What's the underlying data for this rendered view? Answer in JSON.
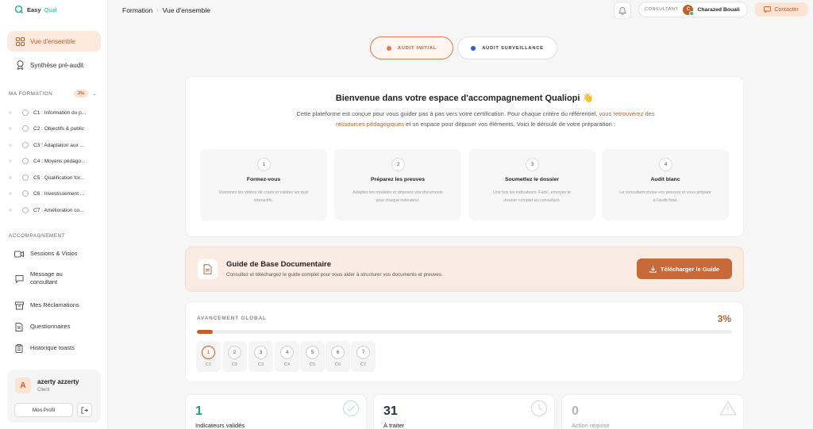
{
  "brand": {
    "name": "Easy",
    "accent": "Qual"
  },
  "sidebar": {
    "nav": [
      {
        "label": "Vue d'ensemble",
        "icon": "grid-icon",
        "active": true
      },
      {
        "label": "Synthèse pré-audit",
        "icon": "award-icon",
        "active": false
      }
    ],
    "formation_title": "MA FORMATION",
    "formation_pct": "3%",
    "criteria": [
      "C1 : Information du p...",
      "C2 : Objectifs & public",
      "C3 : Adaptation aux ...",
      "C4 : Moyens pédago...",
      "C5 : Qualification for...",
      "C6 : Investissement ...",
      "C7 : Amélioration co..."
    ],
    "accompagnement_title": "ACCOMPAGNEMENT",
    "accompagnement": [
      {
        "label": "Sessions & Visios",
        "icon": "video-icon"
      },
      {
        "label": "Message au consultant",
        "icon": "message-icon"
      },
      {
        "label": "Mes Réclamations",
        "icon": "archive-icon"
      },
      {
        "label": "Questionnaires",
        "icon": "document-icon"
      },
      {
        "label": "Historique toasts",
        "icon": "clipboard-icon"
      }
    ],
    "profile": {
      "initial": "A",
      "name": "azerty azzerty",
      "role": "Client",
      "button": "Mon Profil"
    }
  },
  "header": {
    "breadcrumb": [
      "Formation",
      "Vue d'ensemble"
    ],
    "consultant_label": "CONSULTANT",
    "consultant_initial": "C",
    "consultant_name": "Charazed Bouali",
    "contact_label": "Contacter"
  },
  "audit_tabs": [
    {
      "label": "AUDIT INITIAL",
      "active": true,
      "dot_color": "#d77e52"
    },
    {
      "label": "AUDIT SURVEILLANCE",
      "active": false,
      "dot_color": "#2a5fd8"
    }
  ],
  "welcome": {
    "title": "Bienvenue dans votre espace d'accompagnement Qualiopi 👋",
    "text_before": "Cette plateforme est conçue pour vous guider pas à pas vers votre certification. Pour chaque critère du référentiel, ",
    "text_highlight": "vous retrouverez des ressources pédagogiques",
    "text_after": " et un espace pour déposer vos éléments. Voici le déroulé de votre préparation :",
    "steps": [
      {
        "num": "1",
        "title": "Formez-vous",
        "desc": "Visionnez les vidéos de cours et validez les quiz interactifs."
      },
      {
        "num": "2",
        "title": "Préparez les preuves",
        "desc": "Adaptez les modèles et déposez vos documents pour chaque indicateur."
      },
      {
        "num": "3",
        "title": "Soumettez le dossier",
        "desc": "Une fois les indicateurs 'Faits', envoyez le dossier complet au consultant."
      },
      {
        "num": "4",
        "title": "Audit blanc",
        "desc": "Le consultant révise vos preuves et vous prépare à l'audit final."
      }
    ]
  },
  "guide": {
    "title": "Guide de Base Documentaire",
    "desc": "Consultez et téléchargez le guide complet pour vous aider à structurer vos documents et preuves.",
    "button": "Télécharger le Guide"
  },
  "progress": {
    "label": "AVANCEMENT GLOBAL",
    "pct_text": "3%",
    "fraction": 0.03,
    "criteria": [
      {
        "num": "1",
        "code": "C1",
        "active": true
      },
      {
        "num": "2",
        "code": "C2",
        "active": false
      },
      {
        "num": "3",
        "code": "C3",
        "active": false
      },
      {
        "num": "4",
        "code": "C4",
        "active": false
      },
      {
        "num": "5",
        "code": "C5",
        "active": false
      },
      {
        "num": "6",
        "code": "C6",
        "active": false
      },
      {
        "num": "7",
        "code": "C7",
        "active": false
      }
    ]
  },
  "stats": [
    {
      "value": "1",
      "label": "Indicateurs validés",
      "color": "#1f9a7a",
      "icon": "check-circle-icon"
    },
    {
      "value": "31",
      "label": "À traiter",
      "color": "#2a3240",
      "icon": "clock-icon"
    },
    {
      "value": "0",
      "label": "Action requise",
      "color": "#b5b5b5",
      "icon": "warning-icon"
    }
  ]
}
